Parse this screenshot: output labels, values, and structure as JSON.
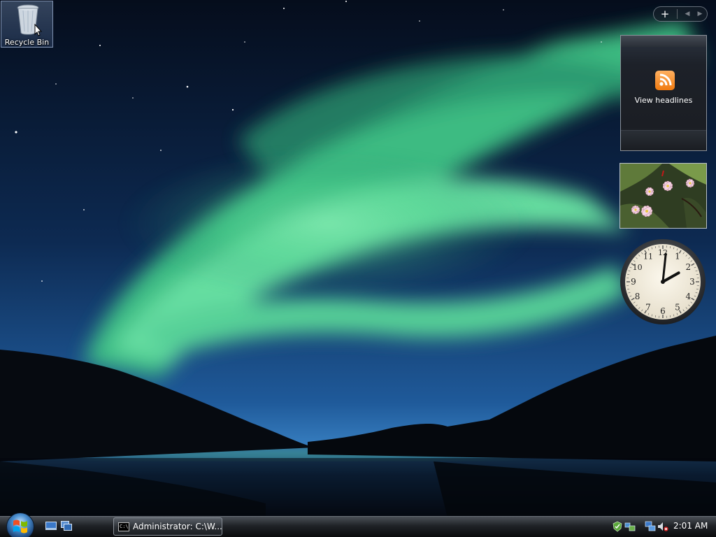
{
  "desktop": {
    "icons": [
      {
        "label": "Recycle Bin",
        "icon": "recycle-bin-icon",
        "selected": true
      }
    ]
  },
  "sidebar": {
    "controls": {
      "add": "+",
      "prev": "◀",
      "next": "▶"
    },
    "feed_gadget": {
      "label": "View headlines",
      "icon": "rss-icon"
    },
    "slideshow_gadget": {
      "subject": "plumeria-flowers"
    },
    "clock_gadget": {
      "numerals": [
        "12",
        "1",
        "2",
        "3",
        "4",
        "5",
        "6",
        "7",
        "8",
        "9",
        "10",
        "11"
      ],
      "hour": 2,
      "minute": 1
    }
  },
  "taskbar": {
    "start_icon": "windows-logo-icon",
    "quick_launch": [
      "show-desktop-icon",
      "switch-windows-icon"
    ],
    "tasks": [
      {
        "label": "Administrator: C:\\W...",
        "icon": "command-prompt-icon",
        "icon_text": "C:\\"
      }
    ],
    "tray": {
      "icons": [
        "windows-defender-icon",
        "network-icon",
        "network-connections-icon",
        "volume-muted-icon"
      ],
      "time": "2:01 AM"
    }
  }
}
